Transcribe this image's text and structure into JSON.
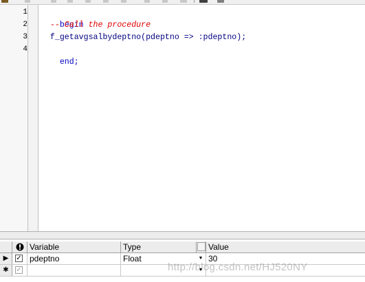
{
  "editor": {
    "line_numbers": [
      "1",
      "2",
      "3",
      "4"
    ],
    "lines": {
      "l1": {
        "kw": "begin"
      },
      "l2": {
        "comment": "-- Call the procedure"
      },
      "l3": {
        "code": "f_getavgsalbydeptno(pdeptno => :pdeptno);"
      },
      "l4": {
        "kw": "end;"
      }
    },
    "colors": {
      "keyword": "#0000c0",
      "comment": "#e00000",
      "identifier": "#000080"
    }
  },
  "grid": {
    "header": {
      "info_icon": "info-icon",
      "variable": "Variable",
      "type": "Type",
      "value": "Value"
    },
    "rows": [
      {
        "selector": "▶",
        "checked": true,
        "variable": "pdeptno",
        "type": "Float",
        "value": "30"
      },
      {
        "selector": "✱",
        "checked": true,
        "variable": "",
        "type": "",
        "value": ""
      }
    ]
  },
  "watermark": "http://blog.csdn.net/HJ520NY"
}
